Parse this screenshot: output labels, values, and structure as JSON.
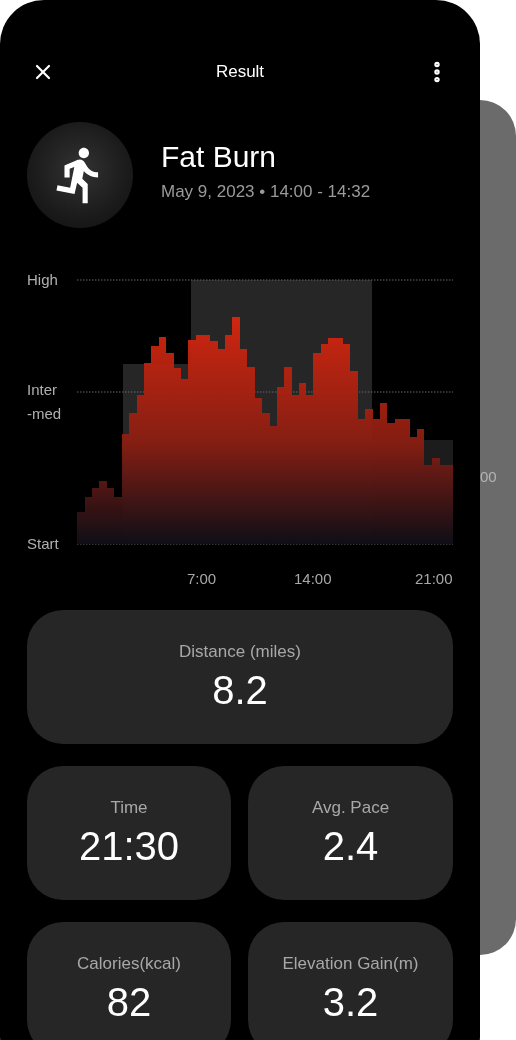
{
  "header": {
    "title": "Result"
  },
  "activity": {
    "name": "Fat Burn",
    "subtitle": "May 9, 2023 • 14:00 - 14:32"
  },
  "chart": {
    "y_labels": [
      "High",
      "Inter\n-med",
      "Start"
    ],
    "x_labels": [
      "7:00",
      "14:00",
      "21:00"
    ]
  },
  "stats": [
    {
      "kind": "wide",
      "label": "Distance (miles)",
      "value": "8.2"
    },
    {
      "kind": "half",
      "label": "Time",
      "value": "21:30"
    },
    {
      "kind": "half",
      "label": "Avg. Pace",
      "value": "2.4"
    },
    {
      "kind": "half",
      "label": "Calories(kcal)",
      "value": "82"
    },
    {
      "kind": "half",
      "label": "Elevation Gain(m)",
      "value": "3.2"
    }
  ],
  "back_card": {
    "text": "00"
  }
}
